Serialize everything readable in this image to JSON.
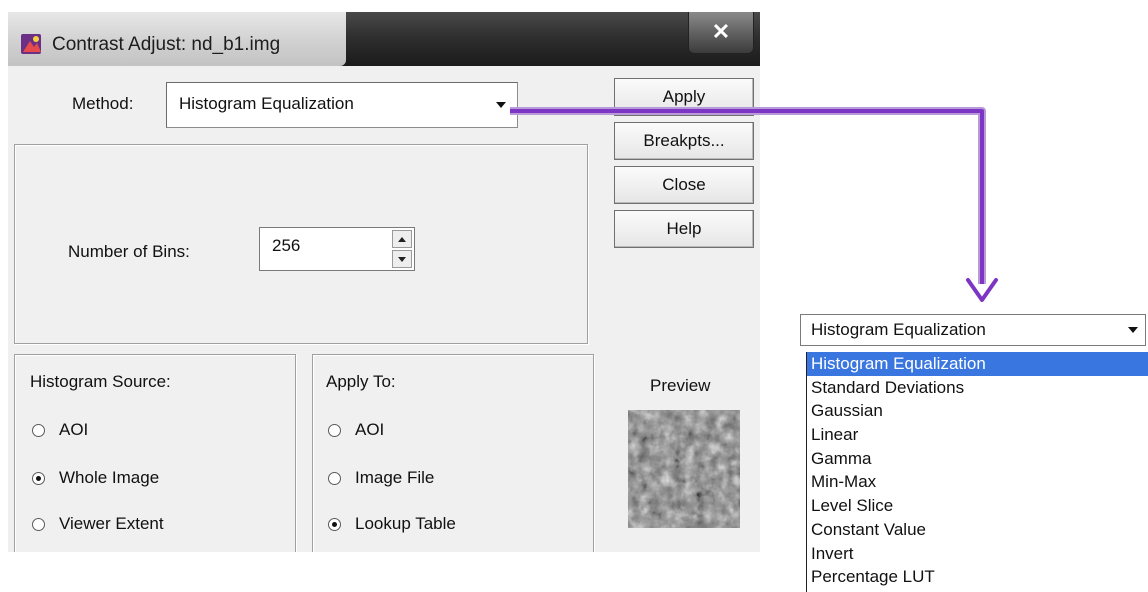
{
  "window": {
    "title": "Contrast Adjust: nd_b1.img",
    "close_label": "✕"
  },
  "method": {
    "label": "Method:",
    "value": "Histogram Equalization"
  },
  "buttons": {
    "apply": "Apply",
    "breakpts": "Breakpts...",
    "close": "Close",
    "help": "Help"
  },
  "bins": {
    "label": "Number of Bins:",
    "value": "256"
  },
  "histogram_source": {
    "title": "Histogram Source:",
    "options": [
      {
        "label": "AOI",
        "checked": false
      },
      {
        "label": "Whole Image",
        "checked": true
      },
      {
        "label": "Viewer Extent",
        "checked": false
      }
    ]
  },
  "apply_to": {
    "title": "Apply To:",
    "options": [
      {
        "label": "AOI",
        "checked": false
      },
      {
        "label": "Image File",
        "checked": false
      },
      {
        "label": "Lookup Table",
        "checked": true
      }
    ]
  },
  "preview": {
    "label": "Preview"
  },
  "dropdown": {
    "selected": "Histogram Equalization",
    "items": [
      "Histogram Equalization",
      "Standard Deviations",
      "Gaussian",
      "Linear",
      "Gamma",
      "Min-Max",
      "Level Slice",
      "Constant Value",
      "Invert",
      "Percentage LUT"
    ]
  },
  "colors": {
    "connector": "#8a3fc9",
    "highlight": "#3a76e0"
  }
}
